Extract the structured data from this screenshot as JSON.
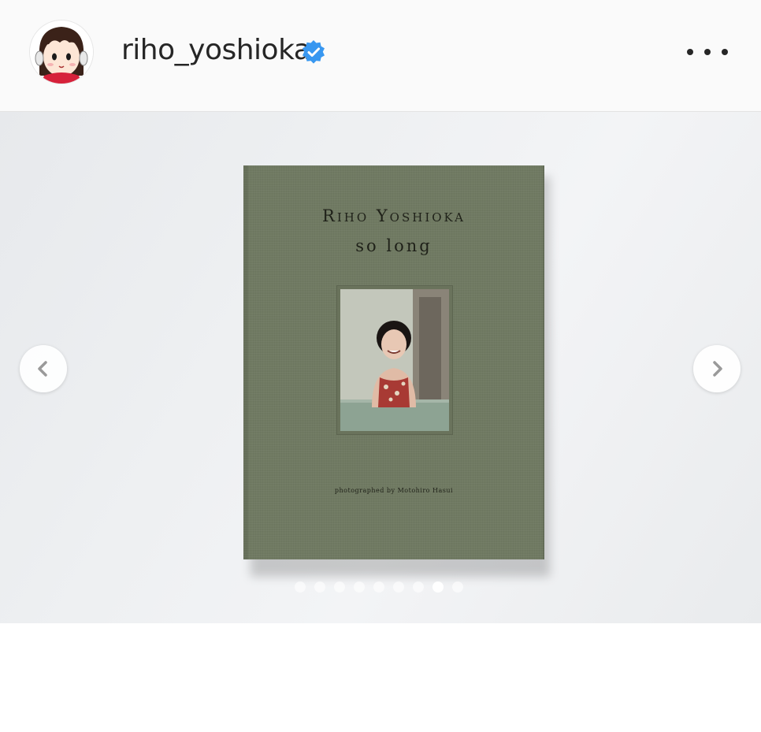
{
  "post_header": {
    "username": "riho_yoshioka",
    "verified": true,
    "avatar_icon": "cartoon-girl-avatar-icon",
    "more_icon": "more-options-icon"
  },
  "media": {
    "book": {
      "title": "Riho Yoshioka",
      "subtitle": "so long",
      "credit": "photographed by Motohiro Hasui"
    },
    "carousel": {
      "total_slides": 9,
      "active_slide": 8,
      "prev_icon": "chevron-left-icon",
      "next_icon": "chevron-right-icon"
    }
  },
  "colors": {
    "verified_badge": "#3897f0",
    "book_cover": "#707a62",
    "username_text": "#262626"
  }
}
